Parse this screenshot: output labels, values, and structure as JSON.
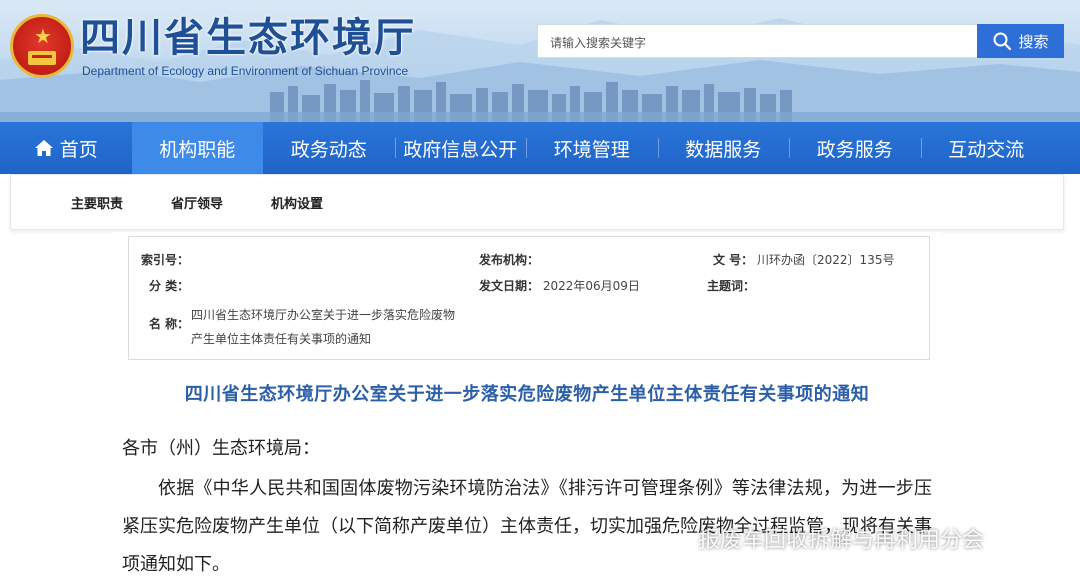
{
  "header": {
    "title": "四川省生态环境厅",
    "subtitle": "Department of Ecology and Environment of Sichuan Province",
    "search_placeholder": "请输入搜索关键字",
    "search_button": "搜索"
  },
  "nav": {
    "items": [
      {
        "label": "首页",
        "icon": "home-icon"
      },
      {
        "label": "机构职能"
      },
      {
        "label": "政务动态"
      },
      {
        "label": "政府信息公开"
      },
      {
        "label": "环境管理"
      },
      {
        "label": "数据服务"
      },
      {
        "label": "政务服务"
      },
      {
        "label": "互动交流"
      }
    ],
    "active": "机构职能"
  },
  "subnav": {
    "items": [
      "主要职责",
      "省厅领导",
      "机构设置"
    ]
  },
  "meta": {
    "index_label": "索引号：",
    "index_value": "",
    "publisher_label": "发布机构：",
    "publisher_value": "",
    "docno_label": "文      号：",
    "docno_value": "川环办函〔2022〕135号",
    "category_label": "分      类：",
    "category_value": "",
    "date_label": "发文日期：",
    "date_value": "2022年06月09日",
    "subject_label": "主题词：",
    "subject_value": "",
    "name_label": "名      称：",
    "name_value_line1": "四川省生态环境厅办公室关于进一步落实危险废物",
    "name_value_line2": "产生单位主体责任有关事项的通知"
  },
  "document": {
    "title": "四川省生态环境厅办公室关于进一步落实危险废物产生单位主体责任有关事项的通知",
    "salutation": "各市（州）生态环境局：",
    "paragraph": "依据《中华人民共和国固体废物污染环境防治法》《排污许可管理条例》等法律法规，为进一步压紧压实危险废物产生单位（以下简称产废单位）主体责任，切实加强危险废物全过程监管，现将有关事项通知如下。"
  },
  "watermark": "报废车回收拆解与再利用分会",
  "colors": {
    "nav_bg": "#1f64c8",
    "nav_active": "#3d8ae8",
    "title_blue": "#2b5fa8",
    "search_button": "#2d6fd6"
  }
}
